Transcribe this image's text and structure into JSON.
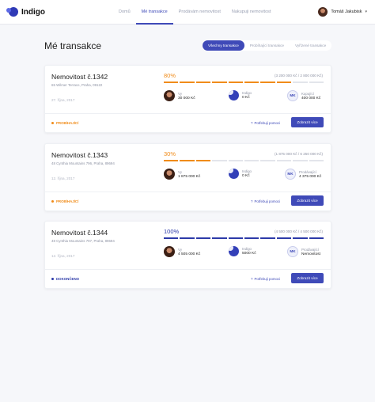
{
  "header": {
    "logo": "Indigo",
    "nav": [
      {
        "label": "Domů",
        "active": false
      },
      {
        "label": "Mé transakce",
        "active": true
      },
      {
        "label": "Prodávám nemovitost",
        "active": false
      },
      {
        "label": "Nakupuji nemovitost",
        "active": false
      }
    ],
    "user_name": "Tomáš Jakubisk"
  },
  "page": {
    "title": "Mé transakce"
  },
  "filters": [
    {
      "label": "Všechny transakce",
      "active": true
    },
    {
      "label": "Probíhající transakce",
      "active": false
    },
    {
      "label": "Vyřízené transakce",
      "active": false
    }
  ],
  "colors": {
    "accent": "#3f4ab8",
    "orange": "#f08c1a",
    "done": "#2c3aa8"
  },
  "transactions": [
    {
      "title": "Nemovitost č.1342",
      "address": "65 Wilmer Terrace, Praha, 09122",
      "date": "27. října, 2017",
      "percent_label": "80%",
      "percent": 80,
      "color": "#f08c1a",
      "amount": "(3 200 000 Kč / 2 800 000 Kč)",
      "parties": [
        {
          "role": "Vy",
          "value": "30 000 Kč"
        },
        {
          "role": "Indigo",
          "value": "0 Kč"
        },
        {
          "role": "Kupující",
          "value": "400 000 Kč",
          "initials": "MK"
        }
      ],
      "status": "PROBÍHAJÍCÍ",
      "help": "Potřebuji pomoci",
      "button": "Zobrazit více"
    },
    {
      "title": "Nemovitost č.1343",
      "address": "48 Cynthia Mountains 796, Praha, 89694",
      "date": "12. října, 2017",
      "percent_label": "30%",
      "percent": 30,
      "color": "#f08c1a",
      "amount": "(1 875 000 Kč / 6 250 000 Kč)",
      "parties": [
        {
          "role": "Vy",
          "value": "1 875 000 Kč"
        },
        {
          "role": "Indigo",
          "value": "0 Kč"
        },
        {
          "role": "Prodávající",
          "value": "4 375 000 Kč",
          "initials": "MK"
        }
      ],
      "status": "PROBÍHAJÍCÍ",
      "help": "Potřebuji pomoci",
      "button": "Zobrazit více"
    },
    {
      "title": "Nemovitost č.1344",
      "address": "48 Cynthia Mountains 797, Praha, 89694",
      "date": "12. října, 2017",
      "percent_label": "100%",
      "percent": 100,
      "color": "#2c3aa8",
      "amount": "(4 500 000 Kč / 4 500 000 Kč)",
      "parties": [
        {
          "role": "Vy",
          "value": "4 505 000 Kč"
        },
        {
          "role": "Indigo",
          "value": "5000 Kč"
        },
        {
          "role": "Prodávající",
          "value": "Nemovitost",
          "initials": "MK"
        }
      ],
      "status": "DOKONČENO",
      "help": "Potřebuji pomoci",
      "button": "Zobrazit více"
    }
  ]
}
